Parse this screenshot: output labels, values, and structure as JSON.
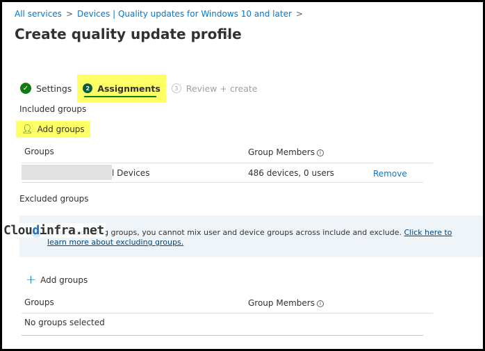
{
  "breadcrumb": [
    {
      "label": "All services"
    },
    {
      "label": "Devices | Quality updates for Windows 10 and later"
    }
  ],
  "breadcrumb_separator": ">",
  "page_title": "Create quality update profile",
  "more_label": "...",
  "tabs": [
    {
      "label": "Settings",
      "state": "completed",
      "icon": "check-circle-icon"
    },
    {
      "label": "Assignments",
      "state": "active",
      "number": "2"
    },
    {
      "label": "Review + create",
      "state": "disabled",
      "number": "3"
    }
  ],
  "included": {
    "heading": "Included groups",
    "add_label": "Add groups",
    "columns": [
      "Groups",
      "Group Members"
    ],
    "rows": [
      {
        "group": "l Devices",
        "members": "486 devices, 0 users",
        "action": "Remove"
      }
    ]
  },
  "excluded": {
    "heading": "Excluded groups",
    "banner_text": "When excluding groups, you cannot mix user and device groups across include and exclude.",
    "banner_link": "Click here to learn more about excluding groups.",
    "add_label": "Add groups",
    "columns": [
      "Groups",
      "Group Members"
    ],
    "empty_text": "No groups selected"
  },
  "watermark": {
    "prefix": "Clou",
    "icon_letter": "d",
    "suffix": "infra.net"
  }
}
